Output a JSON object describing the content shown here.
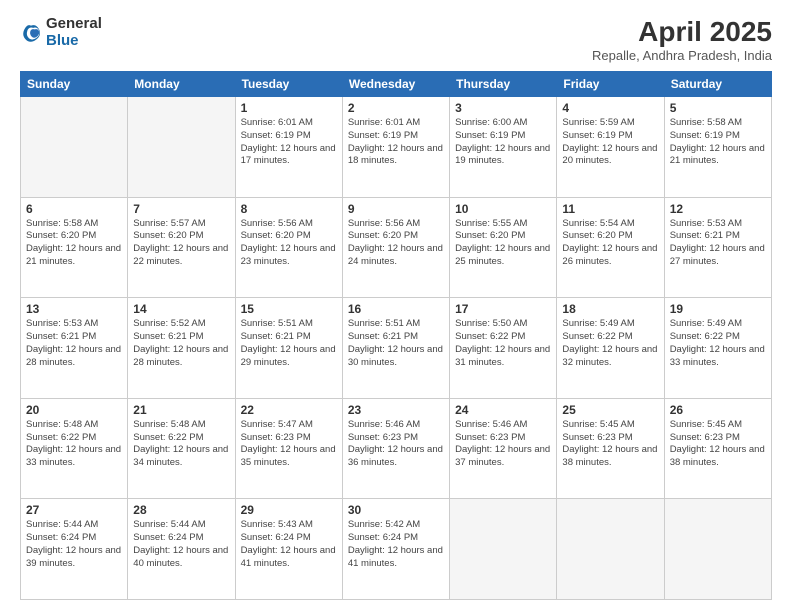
{
  "logo": {
    "general": "General",
    "blue": "Blue"
  },
  "title": "April 2025",
  "subtitle": "Repalle, Andhra Pradesh, India",
  "days_header": [
    "Sunday",
    "Monday",
    "Tuesday",
    "Wednesday",
    "Thursday",
    "Friday",
    "Saturday"
  ],
  "weeks": [
    [
      {
        "day": "",
        "info": ""
      },
      {
        "day": "",
        "info": ""
      },
      {
        "day": "1",
        "info": "Sunrise: 6:01 AM\nSunset: 6:19 PM\nDaylight: 12 hours and 17 minutes."
      },
      {
        "day": "2",
        "info": "Sunrise: 6:01 AM\nSunset: 6:19 PM\nDaylight: 12 hours and 18 minutes."
      },
      {
        "day": "3",
        "info": "Sunrise: 6:00 AM\nSunset: 6:19 PM\nDaylight: 12 hours and 19 minutes."
      },
      {
        "day": "4",
        "info": "Sunrise: 5:59 AM\nSunset: 6:19 PM\nDaylight: 12 hours and 20 minutes."
      },
      {
        "day": "5",
        "info": "Sunrise: 5:58 AM\nSunset: 6:19 PM\nDaylight: 12 hours and 21 minutes."
      }
    ],
    [
      {
        "day": "6",
        "info": "Sunrise: 5:58 AM\nSunset: 6:20 PM\nDaylight: 12 hours and 21 minutes."
      },
      {
        "day": "7",
        "info": "Sunrise: 5:57 AM\nSunset: 6:20 PM\nDaylight: 12 hours and 22 minutes."
      },
      {
        "day": "8",
        "info": "Sunrise: 5:56 AM\nSunset: 6:20 PM\nDaylight: 12 hours and 23 minutes."
      },
      {
        "day": "9",
        "info": "Sunrise: 5:56 AM\nSunset: 6:20 PM\nDaylight: 12 hours and 24 minutes."
      },
      {
        "day": "10",
        "info": "Sunrise: 5:55 AM\nSunset: 6:20 PM\nDaylight: 12 hours and 25 minutes."
      },
      {
        "day": "11",
        "info": "Sunrise: 5:54 AM\nSunset: 6:20 PM\nDaylight: 12 hours and 26 minutes."
      },
      {
        "day": "12",
        "info": "Sunrise: 5:53 AM\nSunset: 6:21 PM\nDaylight: 12 hours and 27 minutes."
      }
    ],
    [
      {
        "day": "13",
        "info": "Sunrise: 5:53 AM\nSunset: 6:21 PM\nDaylight: 12 hours and 28 minutes."
      },
      {
        "day": "14",
        "info": "Sunrise: 5:52 AM\nSunset: 6:21 PM\nDaylight: 12 hours and 28 minutes."
      },
      {
        "day": "15",
        "info": "Sunrise: 5:51 AM\nSunset: 6:21 PM\nDaylight: 12 hours and 29 minutes."
      },
      {
        "day": "16",
        "info": "Sunrise: 5:51 AM\nSunset: 6:21 PM\nDaylight: 12 hours and 30 minutes."
      },
      {
        "day": "17",
        "info": "Sunrise: 5:50 AM\nSunset: 6:22 PM\nDaylight: 12 hours and 31 minutes."
      },
      {
        "day": "18",
        "info": "Sunrise: 5:49 AM\nSunset: 6:22 PM\nDaylight: 12 hours and 32 minutes."
      },
      {
        "day": "19",
        "info": "Sunrise: 5:49 AM\nSunset: 6:22 PM\nDaylight: 12 hours and 33 minutes."
      }
    ],
    [
      {
        "day": "20",
        "info": "Sunrise: 5:48 AM\nSunset: 6:22 PM\nDaylight: 12 hours and 33 minutes."
      },
      {
        "day": "21",
        "info": "Sunrise: 5:48 AM\nSunset: 6:22 PM\nDaylight: 12 hours and 34 minutes."
      },
      {
        "day": "22",
        "info": "Sunrise: 5:47 AM\nSunset: 6:23 PM\nDaylight: 12 hours and 35 minutes."
      },
      {
        "day": "23",
        "info": "Sunrise: 5:46 AM\nSunset: 6:23 PM\nDaylight: 12 hours and 36 minutes."
      },
      {
        "day": "24",
        "info": "Sunrise: 5:46 AM\nSunset: 6:23 PM\nDaylight: 12 hours and 37 minutes."
      },
      {
        "day": "25",
        "info": "Sunrise: 5:45 AM\nSunset: 6:23 PM\nDaylight: 12 hours and 38 minutes."
      },
      {
        "day": "26",
        "info": "Sunrise: 5:45 AM\nSunset: 6:23 PM\nDaylight: 12 hours and 38 minutes."
      }
    ],
    [
      {
        "day": "27",
        "info": "Sunrise: 5:44 AM\nSunset: 6:24 PM\nDaylight: 12 hours and 39 minutes."
      },
      {
        "day": "28",
        "info": "Sunrise: 5:44 AM\nSunset: 6:24 PM\nDaylight: 12 hours and 40 minutes."
      },
      {
        "day": "29",
        "info": "Sunrise: 5:43 AM\nSunset: 6:24 PM\nDaylight: 12 hours and 41 minutes."
      },
      {
        "day": "30",
        "info": "Sunrise: 5:42 AM\nSunset: 6:24 PM\nDaylight: 12 hours and 41 minutes."
      },
      {
        "day": "",
        "info": ""
      },
      {
        "day": "",
        "info": ""
      },
      {
        "day": "",
        "info": ""
      }
    ]
  ]
}
